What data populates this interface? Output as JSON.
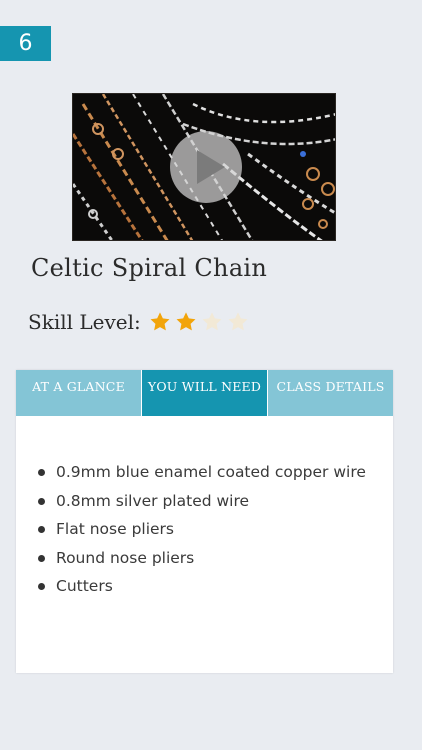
{
  "badge": {
    "number": "6"
  },
  "video": {
    "thumbnail_icon": "play-icon"
  },
  "title": "Celtic Spiral Chain",
  "skill": {
    "label": "Skill Level:",
    "rating": 2,
    "max": 5,
    "shown_stars": 4,
    "star_color": "#f2a40a",
    "star_empty_color": "#f2e9d6"
  },
  "tabs": [
    {
      "label": "AT A GLANCE",
      "active": false
    },
    {
      "label": "YOU WILL NEED",
      "active": true
    },
    {
      "label": "CLASS DETAILS",
      "active": false
    }
  ],
  "items": [
    "0.9mm blue enamel coated copper wire",
    "0.8mm silver plated wire",
    "Flat nose pliers",
    "Round nose pliers",
    "Cutters"
  ],
  "colors": {
    "accent": "#1595b0",
    "tab_inactive": "#84c5d6",
    "background": "#e9ecf1"
  }
}
